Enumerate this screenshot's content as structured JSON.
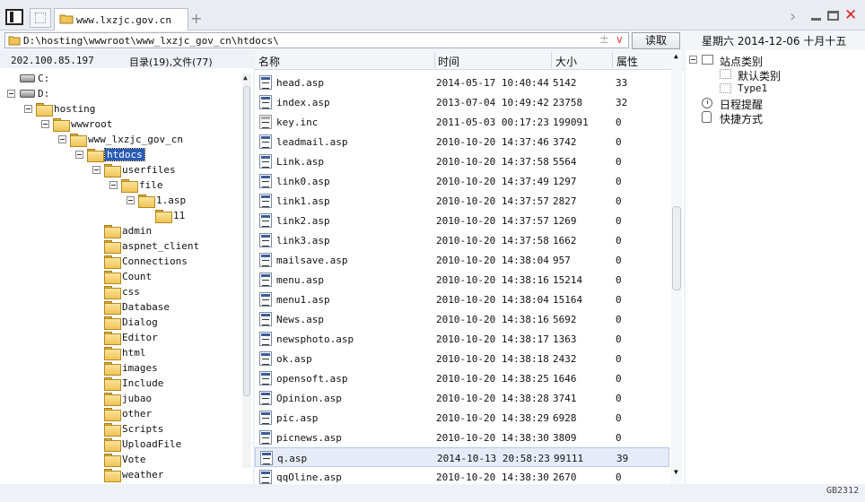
{
  "tabs": {
    "active_label": "www.lxzjc.gov.cn",
    "add_symbol": "+"
  },
  "window_controls": {
    "next_symbol": "›",
    "close_symbol": "✕"
  },
  "address": {
    "path": "D:\\hosting\\wwwroot\\www_lxzjc_gov_cn\\htdocs\\",
    "plus_symbol": "±",
    "dropdown_symbol": "∨",
    "read_button": "读取",
    "date": "星期六 2014-12-06 十月十五"
  },
  "status": {
    "ip": "202.100.85.197",
    "counts": "目录(19),文件(77)"
  },
  "tree": [
    {
      "label": "C:",
      "type": "drive",
      "level": 0,
      "toggle": false
    },
    {
      "label": "D:",
      "type": "drive",
      "level": 0,
      "toggle": true
    },
    {
      "label": "hosting",
      "type": "folder",
      "level": 1,
      "toggle": true
    },
    {
      "label": "wwwroot",
      "type": "folder",
      "level": 2,
      "toggle": true
    },
    {
      "label": "www_lxzjc_gov_cn",
      "type": "folder",
      "level": 3,
      "toggle": true
    },
    {
      "label": "htdocs",
      "type": "folder",
      "level": 4,
      "toggle": true,
      "selected": true
    },
    {
      "label": "userfiles",
      "type": "folder",
      "level": 5,
      "toggle": true
    },
    {
      "label": "file",
      "type": "folder",
      "level": 6,
      "toggle": true
    },
    {
      "label": "1.asp",
      "type": "folder",
      "level": 7,
      "toggle": true
    },
    {
      "label": "11",
      "type": "folder",
      "level": 8,
      "toggle": false
    },
    {
      "label": "admin",
      "type": "folder",
      "level": 5,
      "toggle": false
    },
    {
      "label": "aspnet_client",
      "type": "folder",
      "level": 5,
      "toggle": false
    },
    {
      "label": "Connections",
      "type": "folder",
      "level": 5,
      "toggle": false
    },
    {
      "label": "Count",
      "type": "folder",
      "level": 5,
      "toggle": false
    },
    {
      "label": "css",
      "type": "folder",
      "level": 5,
      "toggle": false
    },
    {
      "label": "Database",
      "type": "folder",
      "level": 5,
      "toggle": false
    },
    {
      "label": "Dialog",
      "type": "folder",
      "level": 5,
      "toggle": false
    },
    {
      "label": "Editor",
      "type": "folder",
      "level": 5,
      "toggle": false
    },
    {
      "label": "html",
      "type": "folder",
      "level": 5,
      "toggle": false
    },
    {
      "label": "images",
      "type": "folder",
      "level": 5,
      "toggle": false
    },
    {
      "label": "Include",
      "type": "folder",
      "level": 5,
      "toggle": false
    },
    {
      "label": "jubao",
      "type": "folder",
      "level": 5,
      "toggle": false
    },
    {
      "label": "other",
      "type": "folder",
      "level": 5,
      "toggle": false
    },
    {
      "label": "Scripts",
      "type": "folder",
      "level": 5,
      "toggle": false
    },
    {
      "label": "UploadFile",
      "type": "folder",
      "level": 5,
      "toggle": false
    },
    {
      "label": "Vote",
      "type": "folder",
      "level": 5,
      "toggle": false
    },
    {
      "label": "weather",
      "type": "folder",
      "level": 5,
      "toggle": false
    }
  ],
  "file_columns": {
    "name": "名称",
    "time": "时间",
    "size": "大小",
    "attr": "属性"
  },
  "files": [
    {
      "name": "head.asp",
      "time": "2014-05-17 10:40:44",
      "size": "5142",
      "attr": "33"
    },
    {
      "name": "index.asp",
      "time": "2013-07-04 10:49:42",
      "size": "23758",
      "attr": "32"
    },
    {
      "name": "key.inc",
      "time": "2011-05-03 00:17:23",
      "size": "199091",
      "attr": "0",
      "kind": "inc"
    },
    {
      "name": "leadmail.asp",
      "time": "2010-10-20 14:37:46",
      "size": "3742",
      "attr": "0"
    },
    {
      "name": "Link.asp",
      "time": "2010-10-20 14:37:58",
      "size": "5564",
      "attr": "0"
    },
    {
      "name": "link0.asp",
      "time": "2010-10-20 14:37:49",
      "size": "1297",
      "attr": "0"
    },
    {
      "name": "link1.asp",
      "time": "2010-10-20 14:37:57",
      "size": "2827",
      "attr": "0"
    },
    {
      "name": "link2.asp",
      "time": "2010-10-20 14:37:57",
      "size": "1269",
      "attr": "0"
    },
    {
      "name": "link3.asp",
      "time": "2010-10-20 14:37:58",
      "size": "1662",
      "attr": "0"
    },
    {
      "name": "mailsave.asp",
      "time": "2010-10-20 14:38:04",
      "size": "957",
      "attr": "0"
    },
    {
      "name": "menu.asp",
      "time": "2010-10-20 14:38:16",
      "size": "15214",
      "attr": "0"
    },
    {
      "name": "menu1.asp",
      "time": "2010-10-20 14:38:04",
      "size": "15164",
      "attr": "0"
    },
    {
      "name": "News.asp",
      "time": "2010-10-20 14:38:16",
      "size": "5692",
      "attr": "0"
    },
    {
      "name": "newsphoto.asp",
      "time": "2010-10-20 14:38:17",
      "size": "1363",
      "attr": "0"
    },
    {
      "name": "ok.asp",
      "time": "2010-10-20 14:38:18",
      "size": "2432",
      "attr": "0"
    },
    {
      "name": "opensoft.asp",
      "time": "2010-10-20 14:38:25",
      "size": "1646",
      "attr": "0"
    },
    {
      "name": "Opinion.asp",
      "time": "2010-10-20 14:38:28",
      "size": "3741",
      "attr": "0"
    },
    {
      "name": "pic.asp",
      "time": "2010-10-20 14:38:29",
      "size": "6928",
      "attr": "0"
    },
    {
      "name": "picnews.asp",
      "time": "2010-10-20 14:38:30",
      "size": "3809",
      "attr": "0"
    },
    {
      "name": "q.asp",
      "time": "2014-10-13 20:58:23",
      "size": "99111",
      "attr": "39",
      "selected": true
    },
    {
      "name": "qqOline.asp",
      "time": "2010-10-20 14:38:30",
      "size": "2670",
      "attr": "0"
    }
  ],
  "right_panel": [
    {
      "label": "站点类别",
      "icon": "box",
      "level": 0,
      "toggle": true
    },
    {
      "label": "默认类别",
      "icon": "dotbox",
      "level": 1
    },
    {
      "label": "Type1",
      "icon": "dotbox",
      "level": 1,
      "mono": true
    },
    {
      "label": "日程提醒",
      "icon": "clock",
      "level": 0
    },
    {
      "label": "快捷方式",
      "icon": "hand",
      "level": 0
    }
  ],
  "footer": {
    "encoding": "GB2312"
  },
  "colors": {
    "selection": "#2b5cb3",
    "close": "#dd2222",
    "folder": "#f0c456"
  }
}
